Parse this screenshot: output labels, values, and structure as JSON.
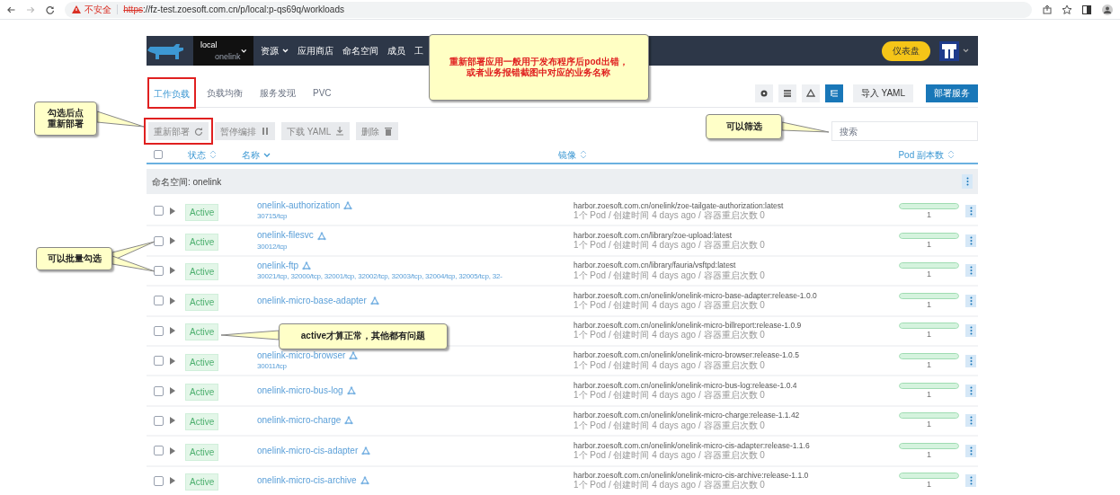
{
  "browser": {
    "warning": "不安全",
    "url_scheme": "https",
    "url_rest": "://fz-test.zoesoft.com.cn/p/local:p-qs69q/workloads"
  },
  "header": {
    "cluster": "local",
    "project": "onelink",
    "nav": [
      {
        "label": "资源",
        "dropdown": true
      },
      {
        "label": "应用商店",
        "dropdown": false
      },
      {
        "label": "命名空间",
        "dropdown": false
      },
      {
        "label": "成员",
        "dropdown": false
      },
      {
        "label": "工",
        "dropdown": false
      }
    ],
    "dashboard_button": "仪表盘"
  },
  "tabs": [
    {
      "label": "工作负载",
      "selected": true,
      "highlighted": true
    },
    {
      "label": "负载均衡",
      "selected": false,
      "highlighted": false
    },
    {
      "label": "服务发现",
      "selected": false,
      "highlighted": false
    },
    {
      "label": "PVC",
      "selected": false,
      "highlighted": false
    }
  ],
  "view_modes": [
    {
      "selected": false
    },
    {
      "selected": false
    },
    {
      "selected": false
    },
    {
      "selected": true
    }
  ],
  "actions": [
    {
      "label": "导入 YAML",
      "kind": "secondary"
    },
    {
      "label": "部署服务",
      "kind": "primary"
    }
  ],
  "bulk_actions": [
    {
      "label": "重新部署",
      "disabled": true,
      "highlighted": true
    },
    {
      "label": "暂停编排",
      "disabled": true,
      "highlighted": false
    },
    {
      "label": "下载 YAML",
      "disabled": true,
      "highlighted": false
    },
    {
      "label": "删除",
      "disabled": true,
      "highlighted": false
    }
  ],
  "search": {
    "placeholder": "搜索"
  },
  "select_all": {
    "checked": false
  },
  "columns": [
    "状态",
    "名称",
    "镜像",
    "Pod 副本数"
  ],
  "group": {
    "label": "命名空间: onelink"
  },
  "rows": [
    {
      "checked": false,
      "status": "Active",
      "name": "onelink-authorization",
      "ports": "30715/tcp",
      "image": "harbor.zoesoft.com.cn/onelink/zoe-tailgate-authorization:latest",
      "meta": "1个 Pod / 创建时间 4 days ago / 容器重启次数 0",
      "pods": "1",
      "level": 1
    },
    {
      "checked": false,
      "status": "Active",
      "name": "onelink-filesvc",
      "ports": "30012/tcp",
      "image": "harbor.zoesoft.com.cn/library/zoe-upload:latest",
      "meta": "1个 Pod / 创建时间 4 days ago / 容器重启次数 0",
      "pods": "1",
      "level": 1
    },
    {
      "checked": false,
      "status": "Active",
      "name": "onelink-ftp",
      "ports": "30021/tcp, 32000/tcp, 32001/tcp, 32002/tcp, 32003/tcp, 32004/tcp, 32005/tcp, 32-",
      "image": "harbor.zoesoft.com.cn/library/fauria/vsftpd:latest",
      "meta": "1个 Pod / 创建时间 4 days ago / 容器重启次数 0",
      "pods": "1",
      "level": 1
    },
    {
      "checked": false,
      "status": "Active",
      "name": "onelink-micro-base-adapter",
      "image": "harbor.zoesoft.com.cn/onelink/onelink-micro-base-adapter:release-1.0.0",
      "meta": "1个 Pod / 创建时间 4 days ago / 容器重启次数 0",
      "pods": "1",
      "level": 1
    },
    {
      "checked": false,
      "status": "Active",
      "image": "harbor.zoesoft.com.cn/onelink/onelink-micro-billreport:release-1.0.9",
      "meta": "1个 Pod / 创建时间 4 days ago / 容器重启次数 0",
      "pods": "1",
      "level": 1
    },
    {
      "checked": false,
      "status": "Active",
      "name": "onelink-micro-browser",
      "ports": "30011/tcp",
      "image": "harbor.zoesoft.com.cn/onelink/onelink-micro-browser:release-1.0.5",
      "meta": "1个 Pod / 创建时间 4 days ago / 容器重启次数 0",
      "pods": "1",
      "level": 1
    },
    {
      "checked": false,
      "status": "Active",
      "name": "onelink-micro-bus-log",
      "image": "harbor.zoesoft.com.cn/onelink/onelink-micro-bus-log:release-1.0.4",
      "meta": "1个 Pod / 创建时间 4 days ago / 容器重启次数 0",
      "pods": "1",
      "level": 1
    },
    {
      "checked": false,
      "status": "Active",
      "name": "onelink-micro-charge",
      "image": "harbor.zoesoft.com.cn/onelink/onelink-micro-charge:release-1.1.42",
      "meta": "1个 Pod / 创建时间 4 days ago / 容器重启次数 0",
      "pods": "1",
      "level": 1
    },
    {
      "checked": false,
      "status": "Active",
      "name": "onelink-micro-cis-adapter",
      "image": "harbor.zoesoft.com.cn/onelink/onelink-micro-cis-adapter:release-1.1.6",
      "meta": "1个 Pod / 创建时间 4 days ago / 容器重启次数 0",
      "pods": "1",
      "level": 1
    },
    {
      "checked": false,
      "status": "Active",
      "name": "onelink-micro-cis-archive",
      "image": "harbor.zoesoft.com.cn/onelink/onelink-micro-cis-archive:release-1.1.0",
      "meta": "1个 Pod / 创建时间 4 days ago / 容器重启次数 0",
      "pods": "1",
      "level": 1
    }
  ],
  "annotations": [
    {
      "kind": "banner",
      "lines": [
        "重新部署应用一般用于发布程序后pod出错，",
        "或者业务报错截图中对应的业务名称"
      ]
    },
    {
      "kind": "note",
      "lines": [
        "勾选后点",
        "重新部署"
      ]
    },
    {
      "kind": "note",
      "lines": [
        "可以筛选"
      ]
    },
    {
      "kind": "note",
      "lines": [
        "可以批量勾选"
      ]
    },
    {
      "kind": "note",
      "lines": [
        "active才算正常，其他都有问题"
      ]
    }
  ]
}
